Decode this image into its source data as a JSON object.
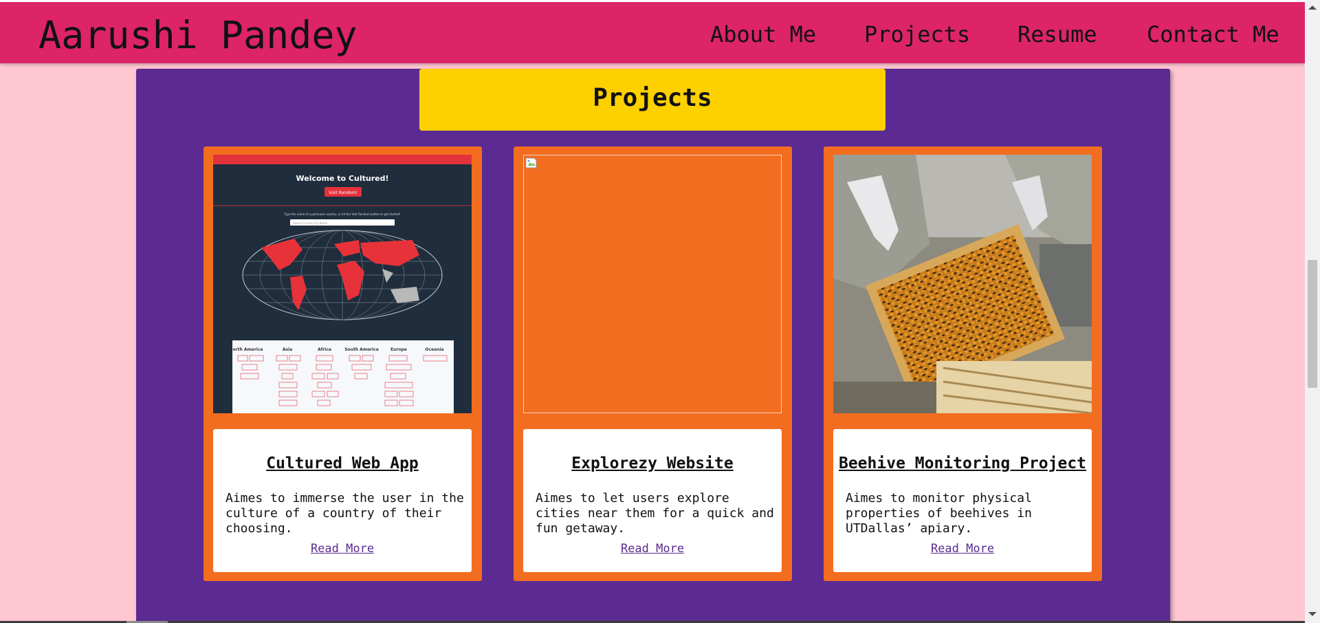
{
  "header": {
    "site_title": "Aarushi Pandey",
    "nav": [
      "About Me",
      "Projects",
      "Resume",
      "Contact Me"
    ]
  },
  "section": {
    "title": "Projects"
  },
  "projects": [
    {
      "title": "Cultured Web App",
      "description": "Aimes to immerse the user in the culture of a country of their choosing.",
      "link_label": "Read More",
      "screenshot": {
        "heading": "Welcome to Cultured!",
        "button": "Visit Random!",
        "prompt": "Type the name of a particular country, or hit the Visit Random button to get started!",
        "search_placeholder": "Search Country by Name",
        "continents": [
          "North America",
          "Asia",
          "Africa",
          "South America",
          "Europe",
          "Oceania"
        ]
      }
    },
    {
      "title": "Explorezy Website",
      "description": "Aimes to let users explore cities near them for a quick and fun getaway.",
      "link_label": "Read More"
    },
    {
      "title": "Beehive Monitoring Project",
      "description": "Aimes to monitor physical properties of beehives in UTDallas’ apiary.",
      "link_label": "Read More"
    }
  ],
  "colors": {
    "page_background": "#ffc7d1",
    "navbar": "#dc2467",
    "panel": "#5b2a92",
    "banner": "#fdd000",
    "card": "#f36d20",
    "link": "#5b2a92"
  }
}
